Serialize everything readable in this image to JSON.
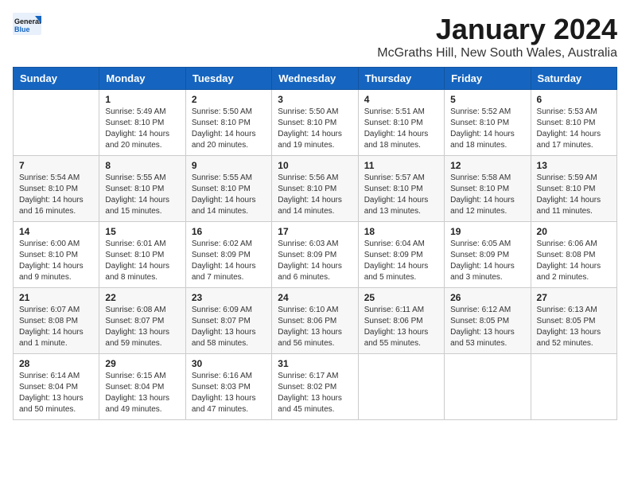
{
  "header": {
    "logo_general": "General",
    "logo_blue": "Blue",
    "month": "January 2024",
    "location": "McGraths Hill, New South Wales, Australia"
  },
  "weekdays": [
    "Sunday",
    "Monday",
    "Tuesday",
    "Wednesday",
    "Thursday",
    "Friday",
    "Saturday"
  ],
  "weeks": [
    [
      {
        "day": "",
        "info": ""
      },
      {
        "day": "1",
        "info": "Sunrise: 5:49 AM\nSunset: 8:10 PM\nDaylight: 14 hours\nand 20 minutes."
      },
      {
        "day": "2",
        "info": "Sunrise: 5:50 AM\nSunset: 8:10 PM\nDaylight: 14 hours\nand 20 minutes."
      },
      {
        "day": "3",
        "info": "Sunrise: 5:50 AM\nSunset: 8:10 PM\nDaylight: 14 hours\nand 19 minutes."
      },
      {
        "day": "4",
        "info": "Sunrise: 5:51 AM\nSunset: 8:10 PM\nDaylight: 14 hours\nand 18 minutes."
      },
      {
        "day": "5",
        "info": "Sunrise: 5:52 AM\nSunset: 8:10 PM\nDaylight: 14 hours\nand 18 minutes."
      },
      {
        "day": "6",
        "info": "Sunrise: 5:53 AM\nSunset: 8:10 PM\nDaylight: 14 hours\nand 17 minutes."
      }
    ],
    [
      {
        "day": "7",
        "info": "Sunrise: 5:54 AM\nSunset: 8:10 PM\nDaylight: 14 hours\nand 16 minutes."
      },
      {
        "day": "8",
        "info": "Sunrise: 5:55 AM\nSunset: 8:10 PM\nDaylight: 14 hours\nand 15 minutes."
      },
      {
        "day": "9",
        "info": "Sunrise: 5:55 AM\nSunset: 8:10 PM\nDaylight: 14 hours\nand 14 minutes."
      },
      {
        "day": "10",
        "info": "Sunrise: 5:56 AM\nSunset: 8:10 PM\nDaylight: 14 hours\nand 14 minutes."
      },
      {
        "day": "11",
        "info": "Sunrise: 5:57 AM\nSunset: 8:10 PM\nDaylight: 14 hours\nand 13 minutes."
      },
      {
        "day": "12",
        "info": "Sunrise: 5:58 AM\nSunset: 8:10 PM\nDaylight: 14 hours\nand 12 minutes."
      },
      {
        "day": "13",
        "info": "Sunrise: 5:59 AM\nSunset: 8:10 PM\nDaylight: 14 hours\nand 11 minutes."
      }
    ],
    [
      {
        "day": "14",
        "info": "Sunrise: 6:00 AM\nSunset: 8:10 PM\nDaylight: 14 hours\nand 9 minutes."
      },
      {
        "day": "15",
        "info": "Sunrise: 6:01 AM\nSunset: 8:10 PM\nDaylight: 14 hours\nand 8 minutes."
      },
      {
        "day": "16",
        "info": "Sunrise: 6:02 AM\nSunset: 8:09 PM\nDaylight: 14 hours\nand 7 minutes."
      },
      {
        "day": "17",
        "info": "Sunrise: 6:03 AM\nSunset: 8:09 PM\nDaylight: 14 hours\nand 6 minutes."
      },
      {
        "day": "18",
        "info": "Sunrise: 6:04 AM\nSunset: 8:09 PM\nDaylight: 14 hours\nand 5 minutes."
      },
      {
        "day": "19",
        "info": "Sunrise: 6:05 AM\nSunset: 8:09 PM\nDaylight: 14 hours\nand 3 minutes."
      },
      {
        "day": "20",
        "info": "Sunrise: 6:06 AM\nSunset: 8:08 PM\nDaylight: 14 hours\nand 2 minutes."
      }
    ],
    [
      {
        "day": "21",
        "info": "Sunrise: 6:07 AM\nSunset: 8:08 PM\nDaylight: 14 hours\nand 1 minute."
      },
      {
        "day": "22",
        "info": "Sunrise: 6:08 AM\nSunset: 8:07 PM\nDaylight: 13 hours\nand 59 minutes."
      },
      {
        "day": "23",
        "info": "Sunrise: 6:09 AM\nSunset: 8:07 PM\nDaylight: 13 hours\nand 58 minutes."
      },
      {
        "day": "24",
        "info": "Sunrise: 6:10 AM\nSunset: 8:06 PM\nDaylight: 13 hours\nand 56 minutes."
      },
      {
        "day": "25",
        "info": "Sunrise: 6:11 AM\nSunset: 8:06 PM\nDaylight: 13 hours\nand 55 minutes."
      },
      {
        "day": "26",
        "info": "Sunrise: 6:12 AM\nSunset: 8:05 PM\nDaylight: 13 hours\nand 53 minutes."
      },
      {
        "day": "27",
        "info": "Sunrise: 6:13 AM\nSunset: 8:05 PM\nDaylight: 13 hours\nand 52 minutes."
      }
    ],
    [
      {
        "day": "28",
        "info": "Sunrise: 6:14 AM\nSunset: 8:04 PM\nDaylight: 13 hours\nand 50 minutes."
      },
      {
        "day": "29",
        "info": "Sunrise: 6:15 AM\nSunset: 8:04 PM\nDaylight: 13 hours\nand 49 minutes."
      },
      {
        "day": "30",
        "info": "Sunrise: 6:16 AM\nSunset: 8:03 PM\nDaylight: 13 hours\nand 47 minutes."
      },
      {
        "day": "31",
        "info": "Sunrise: 6:17 AM\nSunset: 8:02 PM\nDaylight: 13 hours\nand 45 minutes."
      },
      {
        "day": "",
        "info": ""
      },
      {
        "day": "",
        "info": ""
      },
      {
        "day": "",
        "info": ""
      }
    ]
  ]
}
